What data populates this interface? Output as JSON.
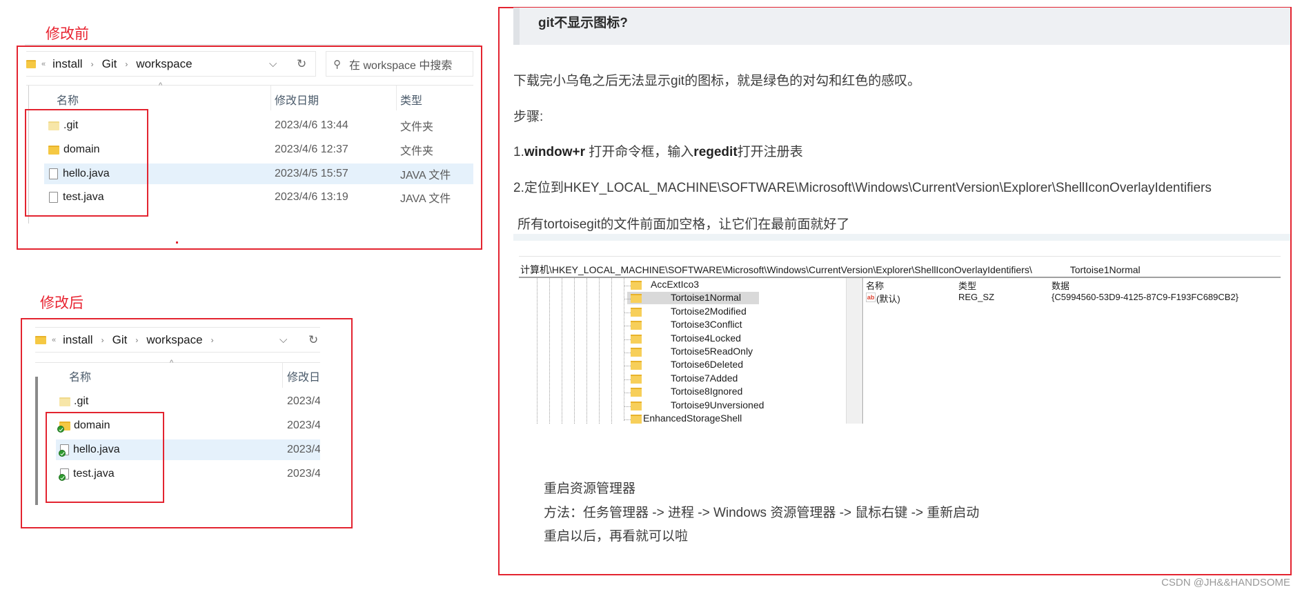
{
  "before": {
    "label": "修改前",
    "breadcrumb": [
      "install",
      "Git",
      "workspace"
    ],
    "overflow_chevron": "«",
    "search_placeholder": "在 workspace 中搜索",
    "columns": [
      "名称",
      "修改日期",
      "类型"
    ],
    "files": [
      {
        "name": ".git",
        "date": "2023/4/6 13:44",
        "type": "文件夹",
        "icon": "folder-pale-icon"
      },
      {
        "name": "domain",
        "date": "2023/4/6 12:37",
        "type": "文件夹",
        "icon": "folder-icon"
      },
      {
        "name": "hello.java",
        "date": "2023/4/5 15:57",
        "type": "JAVA 文件",
        "icon": "file-icon",
        "selected": true
      },
      {
        "name": "test.java",
        "date": "2023/4/6 13:19",
        "type": "JAVA 文件",
        "icon": "file-icon"
      }
    ]
  },
  "after": {
    "label": "修改后",
    "breadcrumb": [
      "install",
      "Git",
      "workspace"
    ],
    "overflow_chevron": "«",
    "columns": [
      "名称",
      "修改日"
    ],
    "files": [
      {
        "name": ".git",
        "date": "2023/4",
        "icon": "folder-pale-icon"
      },
      {
        "name": "domain",
        "date": "2023/4",
        "icon": "folder-synced-icon"
      },
      {
        "name": "hello.java",
        "date": "2023/4",
        "icon": "file-synced-icon",
        "selected": true
      },
      {
        "name": "test.java",
        "date": "2023/4",
        "icon": "file-synced-icon"
      }
    ]
  },
  "article": {
    "heading": "git不显示图标?",
    "intro": "下载完小乌龟之后无法显示git的图标，就是绿色的对勾和红色的感叹。",
    "steps_label": "步骤:",
    "step1": {
      "prefix": "1.",
      "bold1": "window+r",
      "mid": " 打开命令框，输入",
      "bold2": "regedit",
      "suffix": "打开注册表"
    },
    "step2": "2.定位到HKEY_LOCAL_MACHINE\\SOFTWARE\\Microsoft\\Windows\\CurrentVersion\\Explorer\\ShellIconOverlayIdentifiers",
    "note": "所有tortoisegit的文件前面加空格，让它们在最前面就好了",
    "registry": {
      "path": "计算机\\HKEY_LOCAL_MACHINE\\SOFTWARE\\Microsoft\\Windows\\CurrentVersion\\Explorer\\ShellIconOverlayIdentifiers\\",
      "path_selected": "Tortoise1Normal",
      "keys": [
        "AccExtIco3",
        "Tortoise1Normal",
        "Tortoise2Modified",
        "Tortoise3Conflict",
        "Tortoise4Locked",
        "Tortoise5ReadOnly",
        "Tortoise6Deleted",
        "Tortoise7Added",
        "Tortoise8Ignored",
        "Tortoise9Unversioned",
        "EnhancedStorageShell"
      ],
      "selected_key": "Tortoise1Normal",
      "value_columns": [
        "名称",
        "类型",
        "数据"
      ],
      "values": [
        {
          "name": "(默认)",
          "type": "REG_SZ",
          "data": "{C5994560-53D9-4125-87C9-F193FC689CB2}"
        }
      ]
    },
    "restart_title": "重启资源管理器",
    "restart_method": "方法：任务管理器 -> 进程 -> Windows 资源管理器 -> 鼠标右键 -> 重新启动",
    "restart_after": "重启以后，再看就可以啦"
  },
  "watermark": "CSDN @JH&&HANDSOME",
  "colors": {
    "annotation_red": "#e3232f",
    "selection_blue": "#e5f1fb",
    "heading_bg": "#eef0f3"
  }
}
